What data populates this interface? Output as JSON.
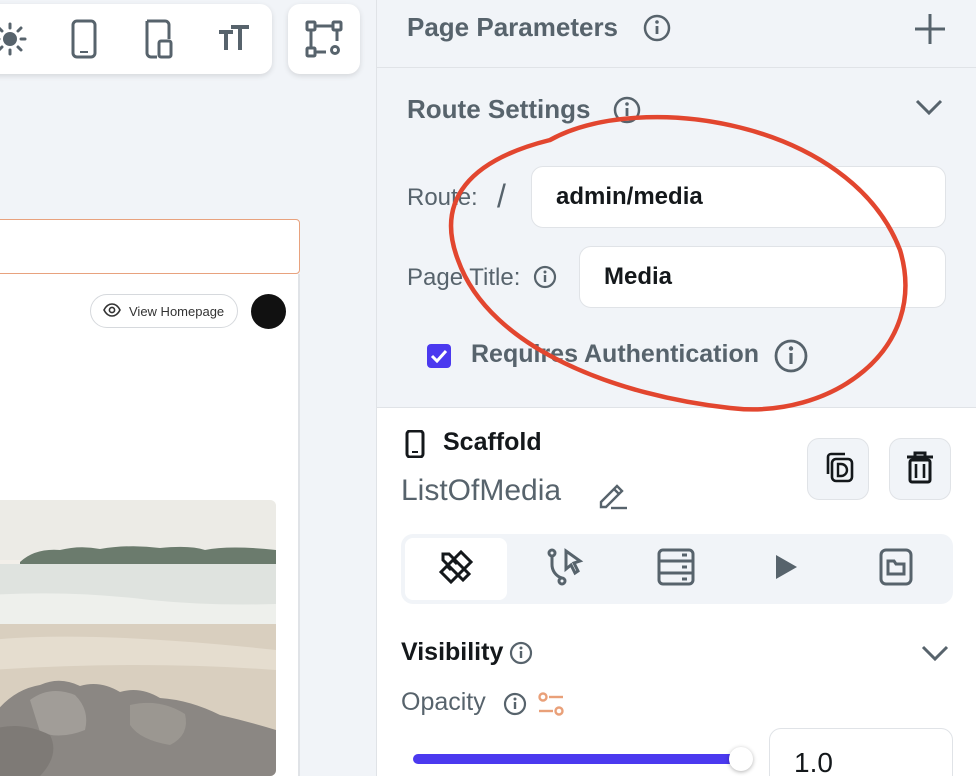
{
  "canvas": {
    "view_homepage_label": "View Homepage"
  },
  "toolbar": {
    "icons": [
      "sun-icon",
      "phone-icon",
      "tablet-icon",
      "text-size-icon",
      "canvas-settings-icon"
    ]
  },
  "page_parameters": {
    "title": "Page Parameters"
  },
  "route_settings": {
    "title": "Route Settings",
    "route_label": "Route:",
    "route_prefix": "/",
    "route_value": "admin/media",
    "page_title_label": "Page Title:",
    "page_title_value": "Media",
    "requires_auth_label": "Requires Authentication",
    "requires_auth_checked": true
  },
  "scaffold": {
    "type_label": "Scaffold",
    "name": "ListOfMedia"
  },
  "tabs": [
    "properties",
    "actions",
    "backend-query",
    "animations",
    "widget-state"
  ],
  "visibility": {
    "title": "Visibility",
    "opacity_label": "Opacity",
    "opacity_value": "1.0"
  },
  "colors": {
    "accent": "#4b39ef",
    "annotation": "#e2462f",
    "panel_bg": "#f1f4f8",
    "muted_text": "#57636c"
  }
}
